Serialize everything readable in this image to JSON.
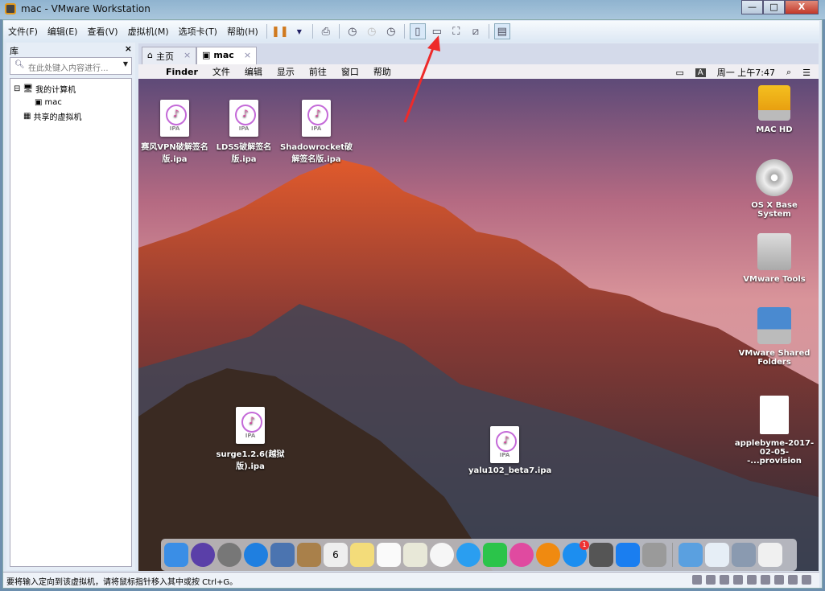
{
  "window": {
    "title": "mac - VMware Workstation",
    "minimize": "—",
    "maximize": "□",
    "close": "X"
  },
  "menu": [
    "文件(F)",
    "编辑(E)",
    "查看(V)",
    "虚拟机(M)",
    "选项卡(T)",
    "帮助(H)"
  ],
  "library": {
    "title": "库",
    "close": "×",
    "search_placeholder": "在此处键入内容进行...",
    "tree": [
      {
        "label": "我的计算机"
      },
      {
        "label": "mac"
      },
      {
        "label": "共享的虚拟机"
      }
    ]
  },
  "tabs": [
    {
      "label": "主页"
    },
    {
      "label": "mac"
    }
  ],
  "mac_menubar": {
    "items": [
      "Finder",
      "文件",
      "编辑",
      "显示",
      "前往",
      "窗口",
      "帮助"
    ],
    "input": "A",
    "clock": "周一 上午7:47"
  },
  "desktop": {
    "files": [
      {
        "label": "赛风VPN破解签名版.ipa"
      },
      {
        "label": "LDSS破解签名版.ipa"
      },
      {
        "label": "Shadowrocket破解签名版.ipa"
      },
      {
        "label": "surge1.2.6(越狱版).ipa"
      },
      {
        "label": "yalu102_beta7.ipa"
      }
    ],
    "volumes": [
      {
        "label": "MAC HD"
      },
      {
        "label": "OS X Base System"
      },
      {
        "label": "VMware Tools"
      },
      {
        "label": "VMware Shared Folders"
      },
      {
        "label": "applebyme-2017-02-05--...provision"
      }
    ]
  },
  "dock": {
    "calendar_day": "6",
    "appstore_badge": "1",
    "colors": [
      "#3a8ee6",
      "#5a3fa8",
      "#777",
      "#1f7fe0",
      "#4b74b0",
      "#a9804a",
      "#eee",
      "#f3dc7a",
      "#fafafa",
      "#e8e8d8",
      "#f6f6f6",
      "#2a9ef0",
      "#2bc44a",
      "#e04aa0",
      "#f08a10",
      "#1c8ef0",
      "#555",
      "#1a7ef0",
      "#9a9a9a",
      "#5aa0e0",
      "#e6eef6",
      "#8a9ab0",
      "#f0f0f0"
    ]
  },
  "status": {
    "text": "要将输入定向到该虚拟机，请将鼠标指针移入其中或按 Ctrl+G。"
  }
}
